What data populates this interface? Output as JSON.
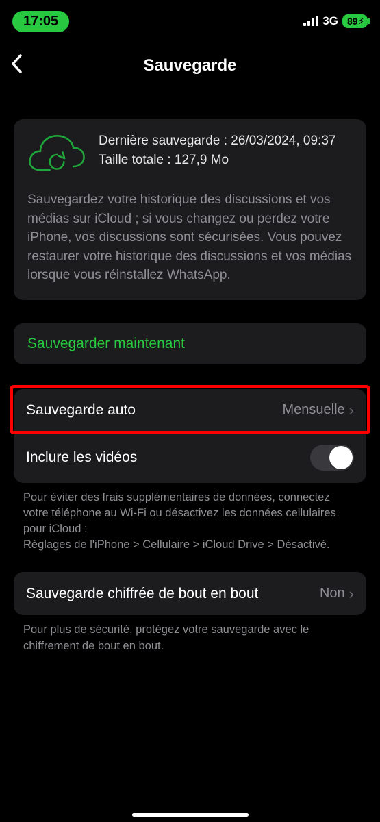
{
  "status": {
    "time": "17:05",
    "network_label": "3G",
    "battery_percent": "89"
  },
  "nav": {
    "title": "Sauvegarde"
  },
  "info": {
    "last_backup": "Dernière sauvegarde : 26/03/2024, 09:37",
    "total_size": "Taille totale : 127,9 Mo",
    "description": "Sauvegardez votre historique des discussions et vos médias sur iCloud ; si vous changez ou perdez votre iPhone, vos discussions sont sécurisées. Vous pouvez restaurer votre historique des discussions et vos médias lorsque vous réinstallez WhatsApp."
  },
  "actions": {
    "backup_now": "Sauvegarder maintenant"
  },
  "settings": {
    "auto_backup_label": "Sauvegarde auto",
    "auto_backup_value": "Mensuelle",
    "include_videos_label": "Inclure les vidéos",
    "footer1": "Pour éviter des frais supplémentaires de données, connectez votre téléphone au Wi-Fi ou désactivez les données cellulaires pour iCloud :\nRéglages de l'iPhone > Cellulaire > iCloud Drive > Désactivé.",
    "e2e_label": "Sauvegarde chiffrée de bout en bout",
    "e2e_value": "Non",
    "footer2": "Pour plus de sécurité, protégez votre sauvegarde avec le chiffrement de bout en bout."
  }
}
